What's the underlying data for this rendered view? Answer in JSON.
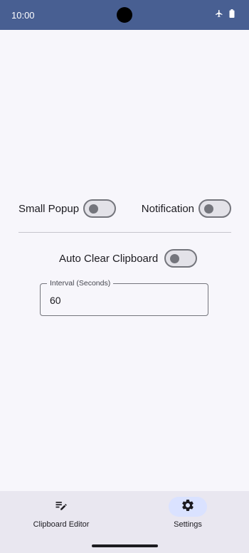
{
  "status_bar": {
    "time": "10:00",
    "icons": [
      "airplane-mode-icon",
      "battery-icon"
    ],
    "background_color": "#485f92"
  },
  "settings": {
    "small_popup": {
      "label": "Small Popup",
      "enabled": false
    },
    "notification": {
      "label": "Notification",
      "enabled": false
    },
    "auto_clear": {
      "label": "Auto Clear Clipboard",
      "enabled": false
    },
    "interval": {
      "label": "Interval (Seconds)",
      "value": "60"
    }
  },
  "bottom_nav": {
    "items": [
      {
        "label": "Clipboard Editor",
        "icon": "edit-notes-icon",
        "active": false
      },
      {
        "label": "Settings",
        "icon": "gear-icon",
        "active": true
      }
    ],
    "active_indicator_color": "#dae2ff"
  }
}
